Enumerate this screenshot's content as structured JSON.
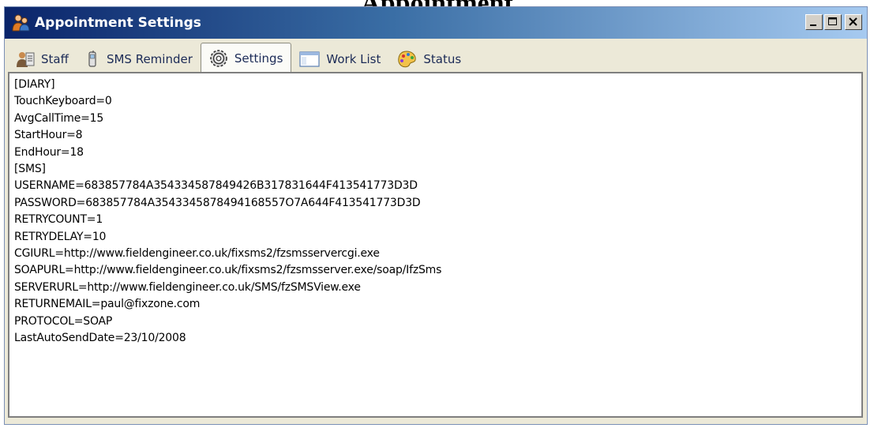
{
  "background": {
    "heading": "Appointment"
  },
  "window": {
    "title": "Appointment Settings"
  },
  "tabs": [
    {
      "label": "Staff",
      "icon": "staff-icon"
    },
    {
      "label": "SMS Reminder",
      "icon": "phone-icon"
    },
    {
      "label": "Settings",
      "icon": "gear-icon",
      "active": true
    },
    {
      "label": "Work List",
      "icon": "list-window-icon"
    },
    {
      "label": "Status",
      "icon": "palette-icon"
    }
  ],
  "settings_text": [
    "[DIARY]",
    "TouchKeyboard=0",
    "AvgCallTime=15",
    "StartHour=8",
    "EndHour=18",
    "[SMS]",
    "USERNAME=683857784A354334587849426B317831644F413541773D3D",
    "PASSWORD=683857784A3543345878494168557O7A644F413541773D3D",
    "RETRYCOUNT=1",
    "RETRYDELAY=10",
    "CGIURL=http://www.fieldengineer.co.uk/fixsms2/fzsmsservercgi.exe",
    "SOAPURL=http://www.fieldengineer.co.uk/fixsms2/fzsmsserver.exe/soap/IfzSms",
    "SERVERURL=http://www.fieldengineer.co.uk/SMS/fzSMSView.exe",
    "RETURNEMAIL=paul@fixzone.com",
    "PROTOCOL=SOAP",
    "LastAutoSendDate=23/10/2008"
  ],
  "colors": {
    "title_start": "#0a246a",
    "title_end": "#a6caf0",
    "window_bg": "#ece9d8",
    "tab_text": "#1b2a56"
  }
}
